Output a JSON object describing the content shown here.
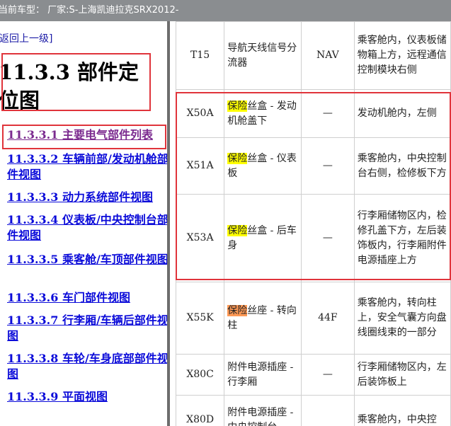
{
  "topbar": {
    "text": "当前车型： 厂家:S-上海凯迪拉克SRX2012-"
  },
  "left": {
    "back_label": "返回上一级]",
    "heading": "11.3.3 部件定位图",
    "nav": [
      {
        "label": "11.3.3.1 主要电气部件列表"
      },
      {
        "label": "11.3.3.2 车辆前部/发动机舱部件视图"
      },
      {
        "label": "11.3.3.3 动力系统部件视图"
      },
      {
        "label": "11.3.3.4 仪表板/中央控制台部件视图"
      },
      {
        "label": "11.3.3.5 乘客舱/车顶部件视图"
      },
      {
        "label": "11.3.3.6 车门部件视图"
      },
      {
        "label": "11.3.3.7 行李厢/车辆后部件视图"
      },
      {
        "label": "11.3.3.8 车轮/车身底部部件视图"
      },
      {
        "label": "11.3.3.9 平面视图"
      }
    ]
  },
  "table": {
    "rows": [
      {
        "code": "T15",
        "name_hl": "",
        "name_rest": "导航天线信号分流器",
        "conn": "NAV",
        "loc": "乘客舱内，仪表板储物箱上方，远程通信控制模块右侧"
      },
      {
        "code": "X50A",
        "name_hl": "保险",
        "name_rest": "丝盒 - 发动机舱盖下",
        "conn": "—",
        "loc": "发动机舱内，左侧"
      },
      {
        "code": "X51A",
        "name_hl": "保险",
        "name_rest": "丝盒 - 仪表板",
        "conn": "—",
        "loc": "乘客舱内，中央控制台右侧，检修板下方"
      },
      {
        "code": "X53A",
        "name_hl": "保险",
        "name_rest": "丝盒 - 后车身",
        "conn": "—",
        "loc": "行李厢储物区内，检修孔盖下方，左后装饰板内，行李厢附件电源插座上方"
      },
      {
        "code": "X55K",
        "name_hl": "保险",
        "name_rest": "丝座 - 转向柱",
        "conn": "44F",
        "loc": "乘客舱内，转向柱上，安全气囊方向盘线圈线束的一部分"
      },
      {
        "code": "X80C",
        "name_hl": "",
        "name_rest": "附件电源插座 - 行李厢",
        "conn": "—",
        "loc": "行李厢储物区内，左后装饰板上"
      },
      {
        "code": "X80D",
        "name_hl": "",
        "name_rest": "附件电源插座 - 中央控制台",
        "conn": "",
        "loc": "乘客舱内，中央控"
      }
    ]
  }
}
